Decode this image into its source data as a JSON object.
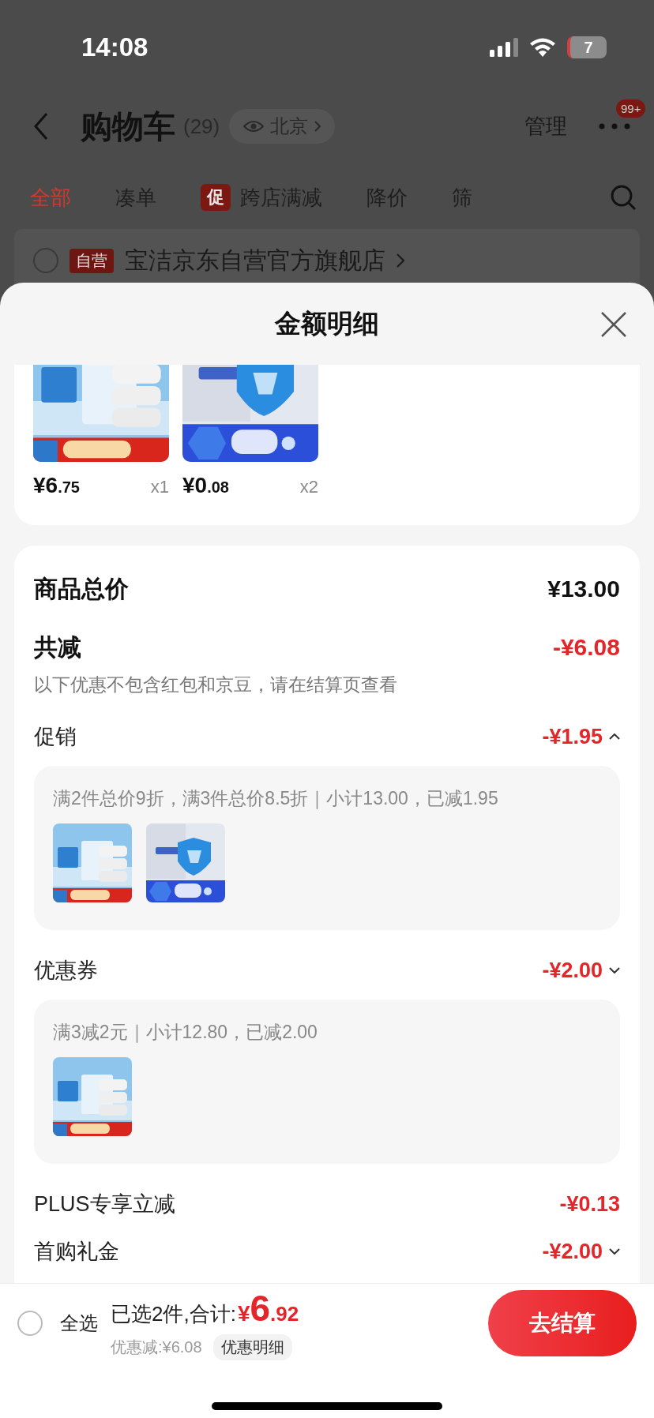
{
  "status_bar": {
    "time": "14:08",
    "battery": "7"
  },
  "header": {
    "title": "购物车",
    "count": "(29)",
    "location": "北京",
    "manage": "管理",
    "more_badge": "99+"
  },
  "tabs": [
    {
      "label": "全部",
      "selected": true
    },
    {
      "label": "凑单",
      "selected": false
    },
    {
      "label": "跨店满减",
      "selected": false,
      "badge": "促"
    },
    {
      "label": "降价",
      "selected": false
    },
    {
      "label": "筛",
      "selected": false
    }
  ],
  "store": {
    "checked": false,
    "tag": "自营",
    "name": "宝洁京东自营官方旗舰店"
  },
  "sheet": {
    "title": "金额明细",
    "items": [
      {
        "kind": "picture",
        "price": "¥6",
        "price_decimal": ".75",
        "quantity": "x1"
      },
      {
        "kind": "picture",
        "price": "¥0",
        "price_decimal": ".08",
        "quantity": "x2"
      }
    ],
    "total": {
      "label": "商品总价",
      "value": "¥13.00"
    },
    "reduction": {
      "label": "共减",
      "value": "-¥6.08",
      "note": "以下优惠不包含红包和京豆，请在结算页查看"
    },
    "discounts": [
      {
        "kind": "expandable",
        "label": "促销",
        "amount": "-¥1.95",
        "chevron_up": true,
        "expanded": true,
        "detail": "满2件总价9折，满3件总价8.5折｜小计13.00，已减1.95"
      },
      {
        "kind": "expandable",
        "label": "优惠券",
        "amount": "-¥2.00",
        "chevron_up": false,
        "expanded": true,
        "detail": "满3减2元｜小计12.80，已减2.00"
      },
      {
        "kind": "plain",
        "label": "PLUS专享立减",
        "amount": "-¥0.13"
      },
      {
        "kind": "expandable",
        "label": "首购礼金",
        "amount": "-¥2.00",
        "chevron_up": false
      }
    ]
  },
  "bottom_bar": {
    "select_all_checked": false,
    "select_all": "全选",
    "selected_text": "已选2件,合计:",
    "currency": "¥",
    "total_int": "6",
    "total_decimal": ".92",
    "saved": "优惠减:¥6.08",
    "detail_chip": "优惠明细",
    "checkout": "去结算"
  }
}
